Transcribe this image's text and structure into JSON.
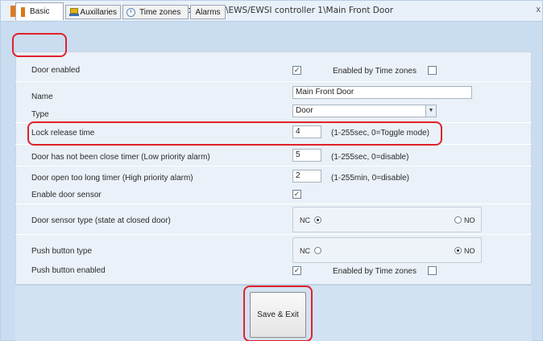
{
  "window": {
    "title": "Portals\\Portal Plus\\EWS/EWSI controller 1\\Main Front Door",
    "close_glyph": "x"
  },
  "tabs": [
    {
      "label": "Basic",
      "icon": "door-icon",
      "active": true
    },
    {
      "label": "Auxillaries",
      "icon": "auxiliaries-icon",
      "active": false
    },
    {
      "label": "Time zones",
      "icon": "clock-icon",
      "active": false
    },
    {
      "label": "Alarms",
      "icon": "",
      "active": false
    }
  ],
  "form": {
    "door_enabled": {
      "label": "Door enabled",
      "checked": true,
      "tz_label": "Enabled by Time zones",
      "tz_checked": false
    },
    "name": {
      "label": "Name",
      "value": "Main Front Door"
    },
    "type": {
      "label": "Type",
      "value": "Door"
    },
    "lock_release": {
      "label": "Lock release time",
      "value": "4",
      "hint": "(1-255sec, 0=Toggle mode)"
    },
    "not_closed": {
      "label": "Door has not been close timer (Low priority alarm)",
      "value": "5",
      "hint": "(1-255sec, 0=disable)"
    },
    "open_too_long": {
      "label": "Door open too long timer (High priority alarm)",
      "value": "2",
      "hint": "(1-255min, 0=disable)"
    },
    "door_sensor": {
      "label": "Enable door sensor",
      "checked": true
    },
    "sensor_type": {
      "label": "Door sensor type (state at closed door)",
      "nc_label": "NC",
      "no_label": "NO",
      "selected": "NC"
    },
    "push_type": {
      "label": "Push button type",
      "nc_label": "NC",
      "no_label": "NO",
      "selected": "NO"
    },
    "push_enabled": {
      "label": "Push button enabled",
      "checked": true,
      "tz_label": "Enabled by Time zones",
      "tz_checked": false
    }
  },
  "footer": {
    "save_label": "Save & Exit"
  },
  "check_glyph": "✓",
  "dropdown_glyph": "▼",
  "highlight_color": "#e0212b"
}
